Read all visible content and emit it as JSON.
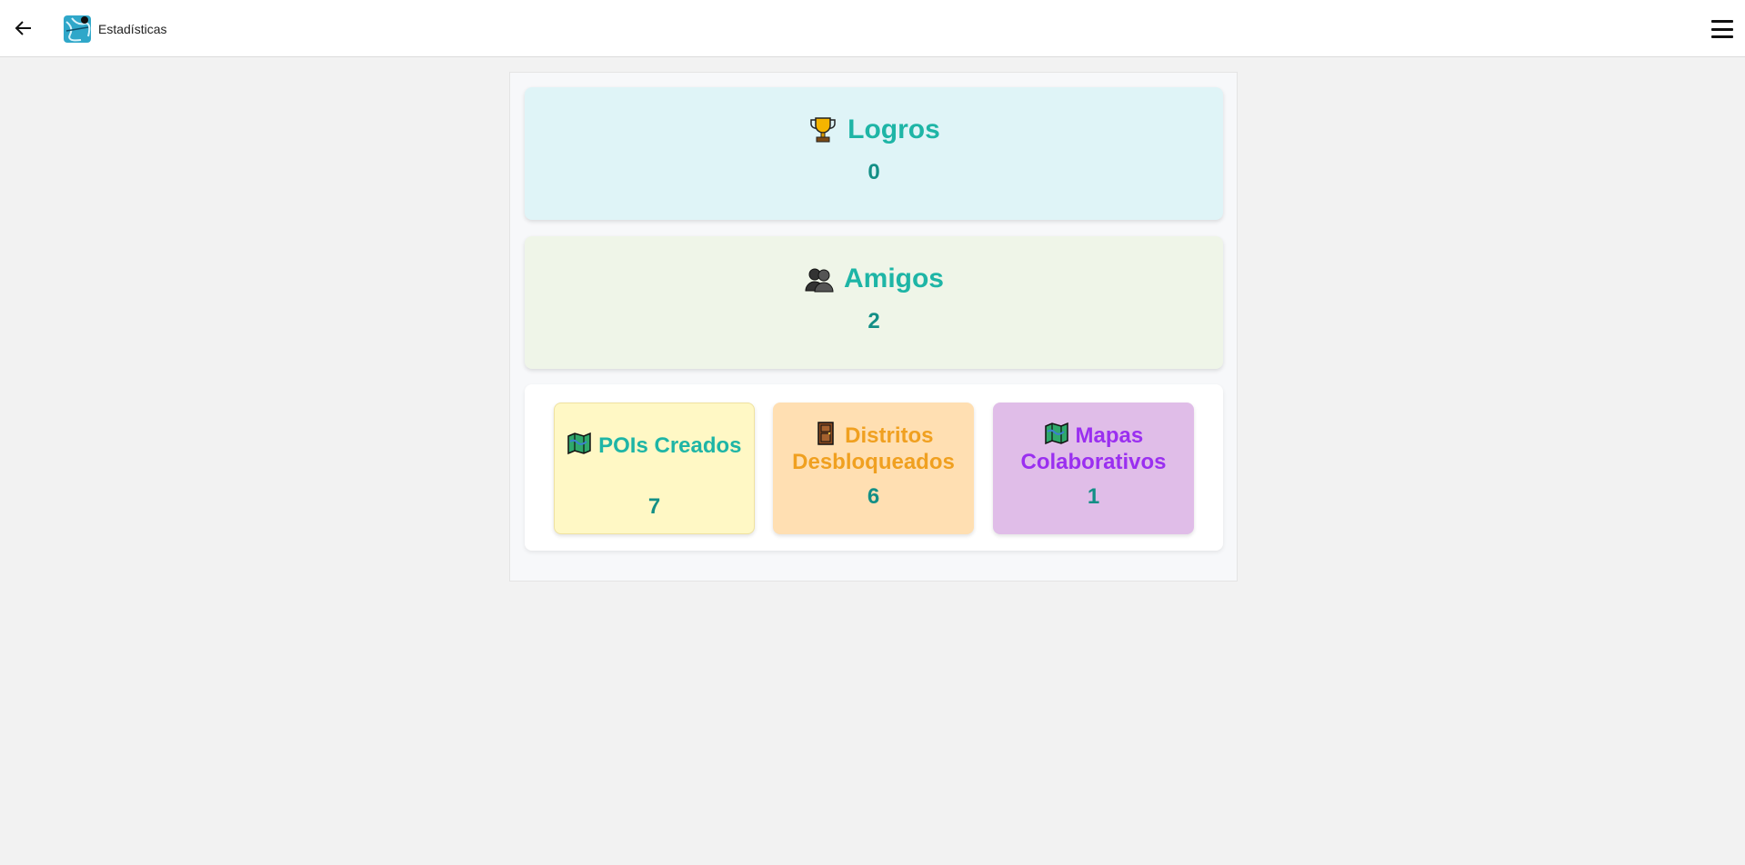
{
  "header": {
    "title": "Estadísticas",
    "back_icon": "arrow-left-icon",
    "logo_icon": "map-logo-icon",
    "menu_icon": "hamburger-menu-icon"
  },
  "stats": {
    "logros": {
      "label": "Logros",
      "value": "0",
      "icon": "trophy-icon"
    },
    "amigos": {
      "label": "Amigos",
      "value": "2",
      "icon": "friends-silhouette-icon"
    }
  },
  "substats": [
    {
      "label": "POIs Creados",
      "value": "7",
      "icon": "map-icon",
      "color": "#1eb5a6"
    },
    {
      "label": "Distritos Desbloqueados",
      "value": "6",
      "icon": "door-icon",
      "color": "#f0a020"
    },
    {
      "label": "Mapas Colaborativos",
      "value": "1",
      "icon": "map-icon",
      "color": "#9a2ff0"
    }
  ],
  "colors": {
    "accent": "#1eb5a6",
    "value": "#138f86",
    "logros_bg": "#dff4f7",
    "amigos_bg": "#eff5e8",
    "pois_bg": "#fff8c5",
    "distritos_bg": "#ffdfb2",
    "mapas_bg": "#e0bde8"
  }
}
